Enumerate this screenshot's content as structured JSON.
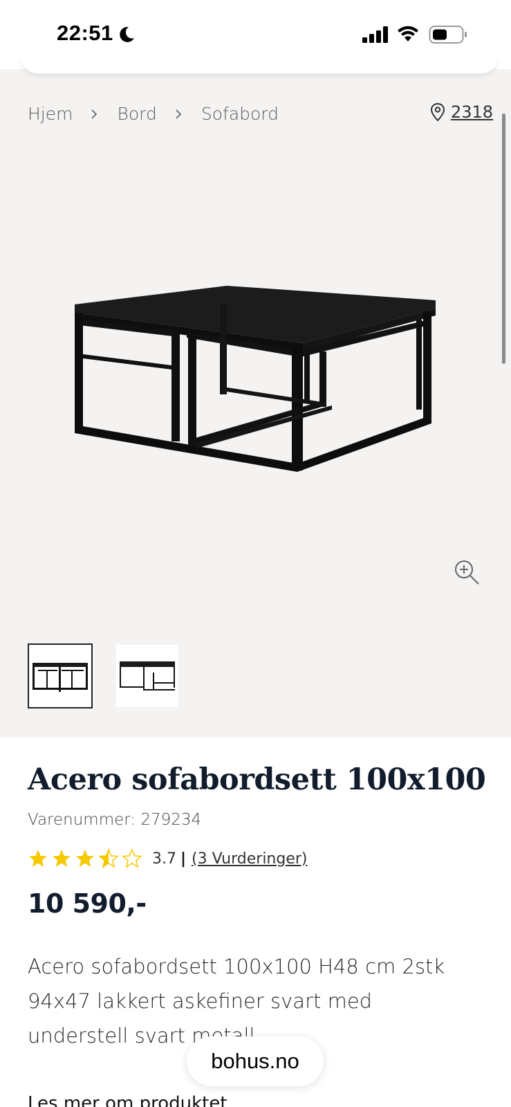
{
  "status_bar": {
    "time": "22:51",
    "icons": [
      "moon-icon",
      "signal-icon",
      "wifi-icon",
      "battery-icon"
    ]
  },
  "breadcrumb": {
    "items": [
      "Hjem",
      "Bord",
      "Sofabord"
    ]
  },
  "store": {
    "label": "2318",
    "icon": "location-pin-icon"
  },
  "gallery": {
    "thumbnails_count": 2,
    "active_index": 0,
    "zoom_icon": "zoom-in-icon"
  },
  "product": {
    "title": "Acero sofabordsett 100x100",
    "sku": "Varenummer: 279234",
    "rating": {
      "value": "3.7",
      "score": 3.7,
      "max": 5,
      "pipe": "|",
      "count_label": "(3 Vurderinger)"
    },
    "price": "10 590,-",
    "description": "Acero sofabordsett 100x100 H48 cm 2stk 94x47 lakkert askefiner svart med understell svart metall",
    "read_more": "Les mer om produktet"
  },
  "browser": {
    "domain": "bohus.no"
  },
  "colors": {
    "gallery_bg": "#f5f3f1",
    "title": "#111c2c",
    "star": "#f5c800"
  }
}
